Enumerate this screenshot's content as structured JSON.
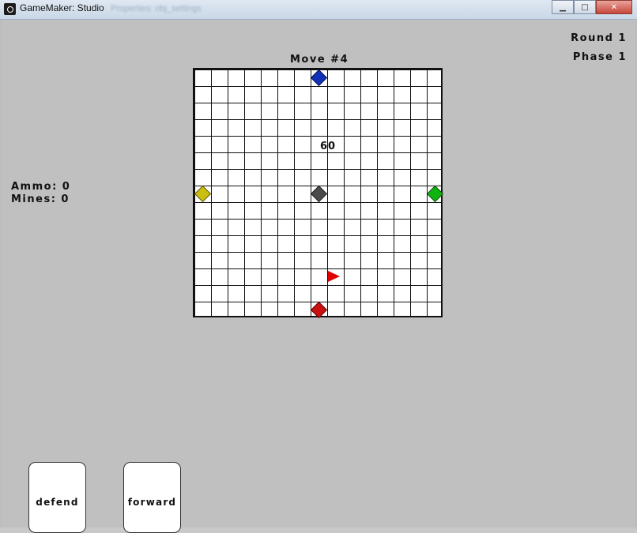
{
  "window": {
    "title": "GameMaker: Studio",
    "background_title": "Properties: obj_settings"
  },
  "hud": {
    "round": "Round 1",
    "phase": "Phase 1",
    "ammo": "Ammo: 0",
    "mines": "Mines: 0",
    "move": "Move #4"
  },
  "board": {
    "rows": 15,
    "cols": 15,
    "center_value": "60",
    "pieces": [
      {
        "name": "blue-player-piece",
        "color": "#1230b8",
        "row": 0,
        "col": 7
      },
      {
        "name": "yellow-player-piece",
        "color": "#c9be11",
        "row": 7,
        "col": 0
      },
      {
        "name": "gray-center-piece",
        "color": "#4a4a4a",
        "row": 7,
        "col": 7
      },
      {
        "name": "green-player-piece",
        "color": "#11b311",
        "row": 7,
        "col": 14
      },
      {
        "name": "red-player-piece",
        "color": "#c90f0f",
        "row": 14,
        "col": 7
      }
    ],
    "arrow": {
      "color": "#e00000",
      "direction": "right",
      "row": 12,
      "col": 8
    }
  },
  "cards": [
    {
      "label": "defend"
    },
    {
      "label": "forward"
    }
  ]
}
